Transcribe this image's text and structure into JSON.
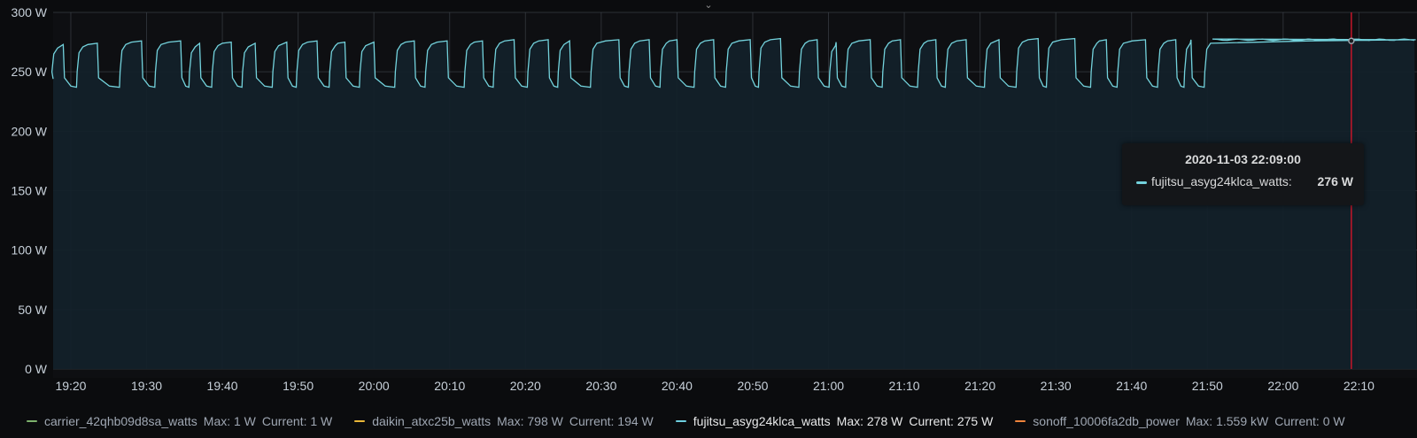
{
  "chart_data": {
    "type": "line",
    "y_unit": "W",
    "ylim": [
      0,
      300
    ],
    "y_ticks": [
      "0 W",
      "50 W",
      "100 W",
      "150 W",
      "200 W",
      "250 W",
      "300 W"
    ],
    "x_tick_labels": [
      "19:20",
      "19:30",
      "19:40",
      "19:50",
      "20:00",
      "20:10",
      "20:20",
      "20:30",
      "20:40",
      "20:50",
      "21:00",
      "21:10",
      "21:20",
      "21:30",
      "21:40",
      "21:50",
      "22:00",
      "22:10"
    ],
    "xlim": [
      "19:17:40",
      "22:17:40"
    ],
    "grid": true,
    "legend_position": "bottom",
    "series": [
      {
        "name": "fujitsu_asyg24klca_watts",
        "color": "#73d2dc",
        "cycles": [
          {
            "start": "19:17:30",
            "end": "19:19:10",
            "high": 273
          },
          {
            "start": "19:20:50",
            "end": "19:23:40",
            "high": 274
          },
          {
            "start": "19:26:30",
            "end": "19:29:30",
            "high": 276
          },
          {
            "start": "19:31:10",
            "end": "19:34:40",
            "high": 276
          },
          {
            "start": "19:35:40",
            "end": "19:37:10",
            "high": 274
          },
          {
            "start": "19:38:40",
            "end": "19:41:20",
            "high": 275
          },
          {
            "start": "19:42:40",
            "end": "19:44:30",
            "high": 274
          },
          {
            "start": "19:46:40",
            "end": "19:48:40",
            "high": 275
          },
          {
            "start": "19:49:50",
            "end": "19:52:40",
            "high": 276
          },
          {
            "start": "19:54:10",
            "end": "19:56:20",
            "high": 275
          },
          {
            "start": "19:58:10",
            "end": "20:00:10",
            "high": 275
          },
          {
            "start": "20:02:50",
            "end": "20:05:30",
            "high": 276
          },
          {
            "start": "20:06:50",
            "end": "20:09:50",
            "high": 276
          },
          {
            "start": "20:12:00",
            "end": "20:14:30",
            "high": 276
          },
          {
            "start": "20:15:50",
            "end": "20:18:40",
            "high": 277
          },
          {
            "start": "20:20:20",
            "end": "20:23:10",
            "high": 277
          },
          {
            "start": "20:24:20",
            "end": "20:26:00",
            "high": 276
          },
          {
            "start": "20:28:40",
            "end": "20:32:30",
            "high": 277
          },
          {
            "start": "20:33:40",
            "end": "20:36:30",
            "high": 277
          },
          {
            "start": "20:37:50",
            "end": "20:40:10",
            "high": 277
          },
          {
            "start": "20:42:20",
            "end": "20:45:00",
            "high": 277
          },
          {
            "start": "20:46:30",
            "end": "20:49:50",
            "high": 277
          },
          {
            "start": "20:50:50",
            "end": "20:53:50",
            "high": 278
          },
          {
            "start": "20:56:10",
            "end": "20:58:40",
            "high": 277
          },
          {
            "start": "21:00:10",
            "end": "21:01:10",
            "high": 275
          },
          {
            "start": "21:02:20",
            "end": "21:05:40",
            "high": 277
          },
          {
            "start": "21:07:10",
            "end": "21:09:40",
            "high": 277
          },
          {
            "start": "21:11:50",
            "end": "21:14:20",
            "high": 277
          },
          {
            "start": "21:15:30",
            "end": "21:18:20",
            "high": 277
          },
          {
            "start": "21:20:40",
            "end": "21:22:40",
            "high": 277
          },
          {
            "start": "21:24:50",
            "end": "21:27:50",
            "high": 278
          },
          {
            "start": "21:28:50",
            "end": "21:32:40",
            "high": 278
          },
          {
            "start": "21:34:40",
            "end": "21:36:50",
            "high": 277
          },
          {
            "start": "21:38:10",
            "end": "21:42:00",
            "high": 277
          },
          {
            "start": "21:43:30",
            "end": "21:46:00",
            "high": 277
          },
          {
            "start": "21:47:00",
            "end": "21:48:00",
            "high": 277
          },
          {
            "start": "21:49:40",
            "end": "22:17:40",
            "high": 277
          }
        ],
        "base_low": 245,
        "drop_low": 237
      }
    ],
    "hover": {
      "time": "22:09:00",
      "value": 276
    }
  },
  "tooltip": {
    "time_label": "2020-11-03 22:09:00",
    "series_label": "fujitsu_asyg24klca_watts:",
    "value_label": "276 W"
  },
  "legend": [
    {
      "name": "carrier_42qhb09d8sa_watts",
      "max": "Max: 1 W",
      "current": "Current: 1 W",
      "color": "#7eb26d",
      "active": false
    },
    {
      "name": "daikin_atxc25b_watts",
      "max": "Max: 798 W",
      "current": "Current: 194 W",
      "color": "#eab839",
      "active": false
    },
    {
      "name": "fujitsu_asyg24klca_watts",
      "max": "Max: 278 W",
      "current": "Current: 275 W",
      "color": "#6ed0e0",
      "active": true
    },
    {
      "name": "sonoff_10006fa2db_power",
      "max": "Max: 1.559 kW",
      "current": "Current: 0 W",
      "color": "#ef843c",
      "active": false
    }
  ],
  "colors": {
    "background": "#0b0c0e",
    "plot_fill": "#13212a",
    "hover_line": "#c4162a"
  }
}
